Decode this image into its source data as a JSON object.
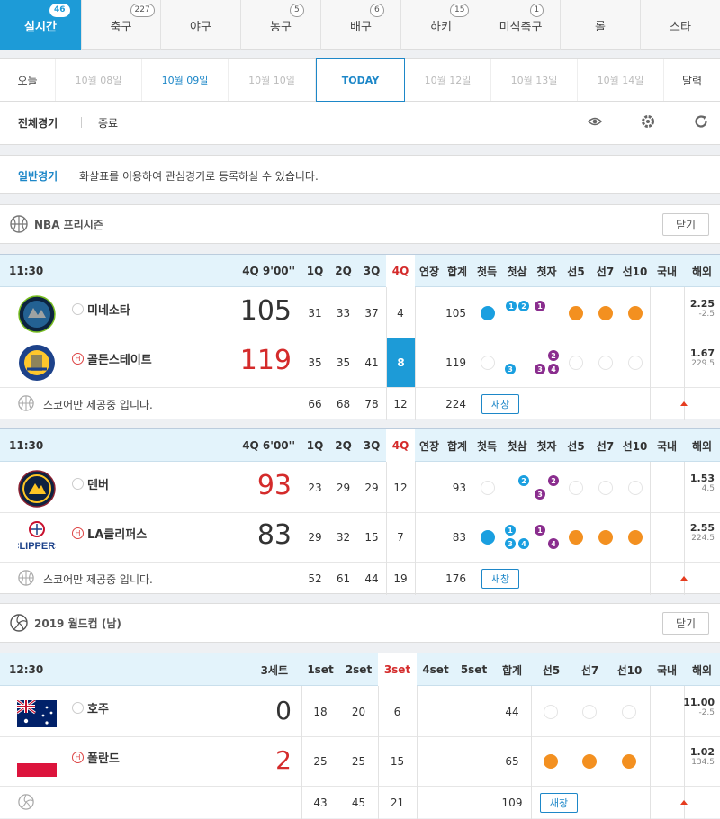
{
  "sport_tabs": [
    {
      "label": "실시간",
      "badge": "46"
    },
    {
      "label": "축구",
      "badge": "227"
    },
    {
      "label": "야구",
      "badge": ""
    },
    {
      "label": "농구",
      "badge": "5"
    },
    {
      "label": "배구",
      "badge": "6"
    },
    {
      "label": "하키",
      "badge": "15"
    },
    {
      "label": "미식축구",
      "badge": "1"
    },
    {
      "label": "롤",
      "badge": ""
    },
    {
      "label": "스타",
      "badge": ""
    }
  ],
  "dates": {
    "today_label": "오늘",
    "d1": "10월 08일",
    "d2": "10월 09일",
    "d3": "10월 10일",
    "today": "TODAY",
    "d5": "10월 12일",
    "d6": "10월 13일",
    "d7": "10월 14일",
    "calendar": "달력"
  },
  "filter": {
    "all": "전체경기",
    "ended": "종료"
  },
  "notice": {
    "tag": "일반경기",
    "text": "화살표를 이용하여 관심경기로 등록하실 수 있습니다."
  },
  "close_label": "닫기",
  "new_window_label": "새창",
  "score_only_text": "스코어만 제공중 입니다.",
  "leagues": {
    "nba": "NBA 프리시즌",
    "volley": "2019 월드컵 (남)"
  },
  "bb_headers": {
    "q1": "1Q",
    "q2": "2Q",
    "q3": "3Q",
    "q4": "4Q",
    "ot": "연장",
    "total": "합계",
    "c1": "첫득",
    "c2": "첫삼",
    "c3": "첫자",
    "c4": "선5",
    "c5": "선7",
    "c6": "선10",
    "dom": "국내",
    "ovs": "해외"
  },
  "game1": {
    "time": "11:30",
    "status": "4Q 9'00''",
    "away": {
      "name": "미네소타",
      "score": "105",
      "q1": "31",
      "q2": "33",
      "q3": "37",
      "q4": "4",
      "ot": "",
      "total": "105",
      "odds": "2.25",
      "line": "-2.5"
    },
    "home": {
      "name": "골든스테이트",
      "score": "119",
      "q1": "35",
      "q2": "35",
      "q3": "41",
      "q4": "8",
      "ot": "",
      "total": "119",
      "odds": "1.67",
      "line": "229.5"
    },
    "sum": {
      "q1": "66",
      "q2": "68",
      "q3": "78",
      "q4": "12",
      "total": "224"
    }
  },
  "game2": {
    "time": "11:30",
    "status": "4Q 6'00''",
    "away": {
      "name": "덴버",
      "score": "93",
      "q1": "23",
      "q2": "29",
      "q3": "29",
      "q4": "12",
      "ot": "",
      "total": "93",
      "odds": "1.53",
      "line": "4.5"
    },
    "home": {
      "name": "LA클리퍼스",
      "score": "83",
      "q1": "29",
      "q2": "32",
      "q3": "15",
      "q4": "7",
      "ot": "",
      "total": "83",
      "odds": "2.55",
      "line": "224.5"
    },
    "sum": {
      "q1": "52",
      "q2": "61",
      "q3": "44",
      "q4": "19",
      "total": "176"
    }
  },
  "vb_headers": {
    "status": "3세트",
    "s1": "1set",
    "s2": "2set",
    "s3": "3set",
    "s4": "4set",
    "s5": "5set",
    "total": "합계",
    "c1": "선5",
    "c2": "선7",
    "c3": "선10",
    "dom": "국내",
    "ovs": "해외"
  },
  "game3": {
    "time": "12:30",
    "away": {
      "name": "호주",
      "score": "0",
      "s1": "18",
      "s2": "20",
      "s3": "6",
      "total": "44",
      "odds": "11.00",
      "line": "-2.5"
    },
    "home": {
      "name": "폴란드",
      "score": "2",
      "s1": "25",
      "s2": "25",
      "s3": "15",
      "total": "65",
      "odds": "1.02",
      "line": "134.5"
    },
    "sum": {
      "s1": "43",
      "s2": "45",
      "s3": "21",
      "total": "109"
    }
  },
  "colors": {
    "accent": "#1d9bd7",
    "win": "#d42b2b",
    "orange": "#f39020",
    "purple": "#8a2d8e"
  }
}
